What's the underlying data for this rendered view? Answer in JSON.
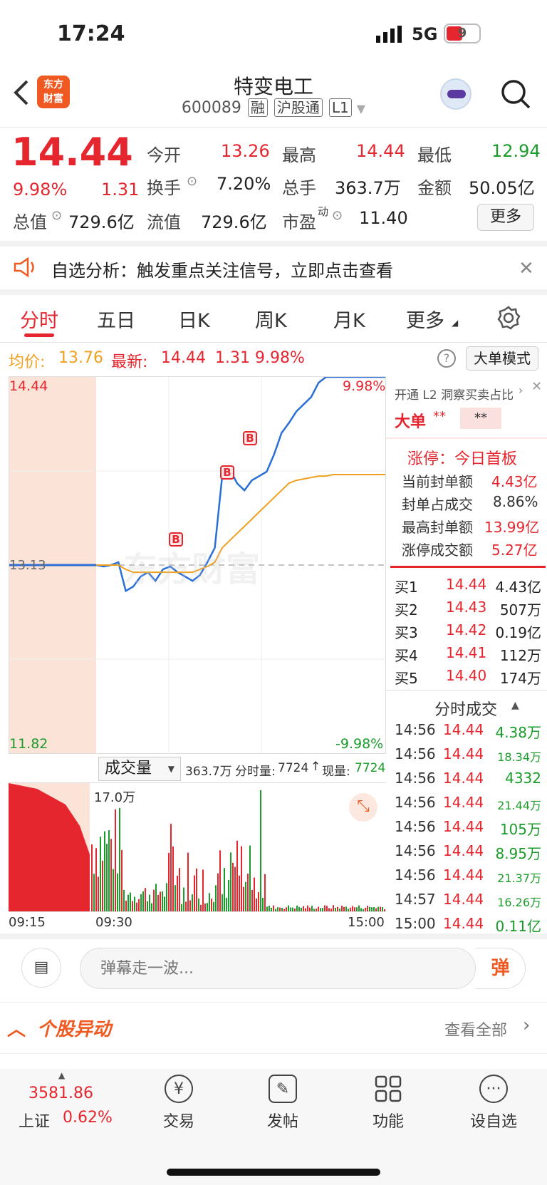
{
  "status_bar": {
    "time": "17:24",
    "network": "5G",
    "battery": "9"
  },
  "header": {
    "title": "特变电工",
    "code": "600089",
    "tags": [
      "融",
      "沪股通",
      "L1"
    ],
    "logo_line1": "东方",
    "logo_line2": "财富"
  },
  "quote": {
    "price": "14.44",
    "change_pct": "9.98%",
    "change": "1.31",
    "open_label": "今开",
    "open": "13.26",
    "high_label": "最高",
    "high": "14.44",
    "low_label": "最低",
    "low": "12.94",
    "turnover_label": "换手",
    "turnover": "7.20%",
    "volume_label": "总手",
    "volume": "363.7万",
    "amount_label": "金额",
    "amount": "50.05亿",
    "mktcap_label": "总值",
    "mktcap": "729.6亿",
    "float_label": "流值",
    "float_cap": "729.6亿",
    "pe_label": "市盈",
    "pe_sup": "动",
    "pe": "11.40",
    "more_label": "更多"
  },
  "banner": {
    "text": "自选分析：触发重点关注信号，立即点击查看"
  },
  "tabs": [
    "分时",
    "五日",
    "日K",
    "周K",
    "月K",
    "更多"
  ],
  "chart_header": {
    "avg_label": "均价:",
    "avg": "13.76",
    "latest_label": "最新:",
    "latest": "14.44",
    "chg": "1.31",
    "chg_pct": "9.98%",
    "mode_label": "大单模式"
  },
  "chart_axis": {
    "y_top": "14.44",
    "y_mid": "13.13",
    "y_bot": "11.82",
    "pct_top": "9.98%",
    "pct_bot": "-9.98%",
    "watermark": "东方财富"
  },
  "vol_header": {
    "selector": "成交量",
    "total": "363.7万",
    "fs_label": "分时量:",
    "fs_val": "7724",
    "now_label": "现量:",
    "now_val": "7724"
  },
  "vol_axis": {
    "max": "17.0万",
    "t1": "09:15",
    "t2": "09:30",
    "t3": "15:00"
  },
  "chart_data": {
    "type": "line",
    "series": [
      {
        "values": [
          13.13,
          13.12,
          13.13,
          13.15,
          12.95,
          12.98,
          13.05,
          13.08,
          13.02,
          13.1,
          13.12,
          13.08,
          13.05,
          13.02,
          13.06,
          13.15,
          13.25,
          13.75,
          13.8,
          13.7,
          13.65,
          13.72,
          13.75,
          13.78,
          13.9,
          14.05,
          14.12,
          14.2,
          14.25,
          14.3,
          14.4,
          14.44,
          14.44,
          14.44,
          14.44,
          14.44,
          14.44,
          14.44,
          14.44,
          14.44
        ]
      },
      {
        "values": [
          13.13,
          13.13,
          13.13,
          13.13,
          13.1,
          13.08,
          13.08,
          13.08,
          13.08,
          13.08,
          13.08,
          13.08,
          13.08,
          13.08,
          13.1,
          13.12,
          13.15,
          13.25,
          13.3,
          13.35,
          13.4,
          13.45,
          13.5,
          13.55,
          13.6,
          13.65,
          13.7,
          13.72,
          13.73,
          13.74,
          13.75,
          13.75,
          13.76,
          13.76,
          13.76,
          13.76,
          13.76,
          13.76,
          13.76,
          13.76
        ]
      }
    ],
    "ylim": [
      11.82,
      14.44
    ]
  },
  "side_panel": {
    "l2_text": "开通 L2 洞察买卖占比",
    "big_label": "大单",
    "big_val1": "**",
    "big_val2": "**",
    "limit_title": "涨停：今日首板",
    "seal_label": "当前封单额",
    "seal_val": "4.43亿",
    "seal_ratio_label": "封单占成交",
    "seal_ratio": "8.86%",
    "max_seal_label": "最高封单额",
    "max_seal": "13.99亿",
    "limit_amt_label": "涨停成交额",
    "limit_amt": "5.27亿"
  },
  "buy_levels": [
    {
      "label": "买1",
      "price": "14.44",
      "vol": "4.43亿"
    },
    {
      "label": "买2",
      "price": "14.43",
      "vol": "507万"
    },
    {
      "label": "买3",
      "price": "14.42",
      "vol": "0.19亿"
    },
    {
      "label": "买4",
      "price": "14.41",
      "vol": "112万"
    },
    {
      "label": "买5",
      "price": "14.40",
      "vol": "174万"
    }
  ],
  "trades_title": "分时成交",
  "trades": [
    {
      "time": "14:56",
      "price": "14.44",
      "vol": "4.38万"
    },
    {
      "time": "14:56",
      "price": "14.44",
      "vol": "18.34万"
    },
    {
      "time": "14:56",
      "price": "14.44",
      "vol": "4332"
    },
    {
      "time": "14:56",
      "price": "14.44",
      "vol": "21.44万"
    },
    {
      "time": "14:56",
      "price": "14.44",
      "vol": "105万"
    },
    {
      "time": "14:56",
      "price": "14.44",
      "vol": "8.95万"
    },
    {
      "time": "14:56",
      "price": "14.44",
      "vol": "21.37万"
    },
    {
      "time": "14:57",
      "price": "14.44",
      "vol": "16.26万"
    },
    {
      "time": "15:00",
      "price": "14.44",
      "vol": "0.11亿"
    }
  ],
  "comment": {
    "placeholder": "弹幕走一波...",
    "danmu": "弹"
  },
  "alerts": {
    "title": "个股异动",
    "view_all": "查看全部"
  },
  "bottom_nav": {
    "index_value": "3581.86",
    "index_name": "上证",
    "index_pct": "0.62%",
    "items": [
      "交易",
      "发帖",
      "功能",
      "设自选"
    ]
  }
}
